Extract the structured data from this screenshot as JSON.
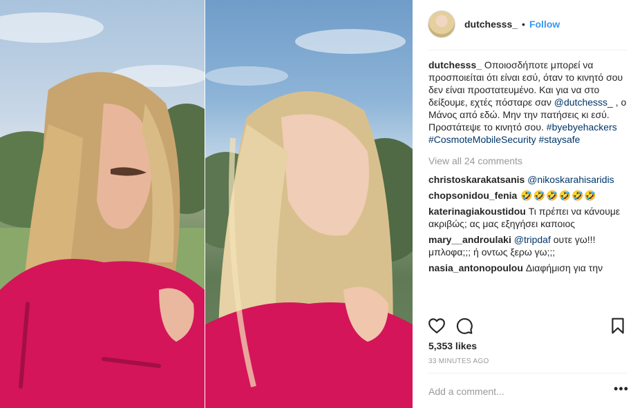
{
  "post": {
    "username": "dutchesss_",
    "dot": "•",
    "follow_label": "Follow"
  },
  "caption": {
    "username": "dutchesss_",
    "text_1": " Οποιοσδήποτε μπορεί να προσποιείται ότι είναι εσύ, όταν το κινητό σου δεν είναι προστατευμένο. Και για να στο δείξουμε, εχτές πόσταρε σαν ",
    "mention": "@dutchesss_",
    "text_2": " , ο Μάνος από εδώ. Μην την πατήσεις κι εσύ. Προστάτεψε το κινητό σου. ",
    "hashtag_1": "#byebyehackers",
    "space": " ",
    "hashtag_2": "#CosmoteMobileSecurity",
    "hashtag_3": "#staysafe"
  },
  "view_all_comments": "View all 24 comments",
  "comments": [
    {
      "username": "christoskarakatsanis",
      "mention": "@nikoskarahisaridis",
      "text": ""
    },
    {
      "username": "chopsonidou_fenia",
      "mention": "",
      "text": " 🤣🤣🤣🤣🤣🤣"
    },
    {
      "username": "katerinagiakoustidou",
      "mention": "",
      "text": " Τι πρέπει να κάνουμε ακριβώς; ας μας εξηγήσει καποιος"
    },
    {
      "username": "mary__androulaki",
      "mention": "@tripdaf",
      "text": " ουτε γω!!! μπλοφα;;; ή οντως ξερω γω;;;"
    },
    {
      "username": "nasia_antonopoulou",
      "mention": "",
      "text": " Διαφήμιση για την"
    }
  ],
  "icons": {
    "like": "heart-icon",
    "comment": "speech-bubble-icon",
    "save": "bookmark-icon",
    "more": "ellipsis-icon"
  },
  "likes": "5,353 likes",
  "timestamp": "33 MINUTES AGO",
  "add_comment_placeholder": "Add a comment...",
  "more_glyph": "•••",
  "colors": {
    "link": "#003569",
    "follow": "#3897f0",
    "muted": "#999999",
    "sweater": "#d4155a"
  }
}
